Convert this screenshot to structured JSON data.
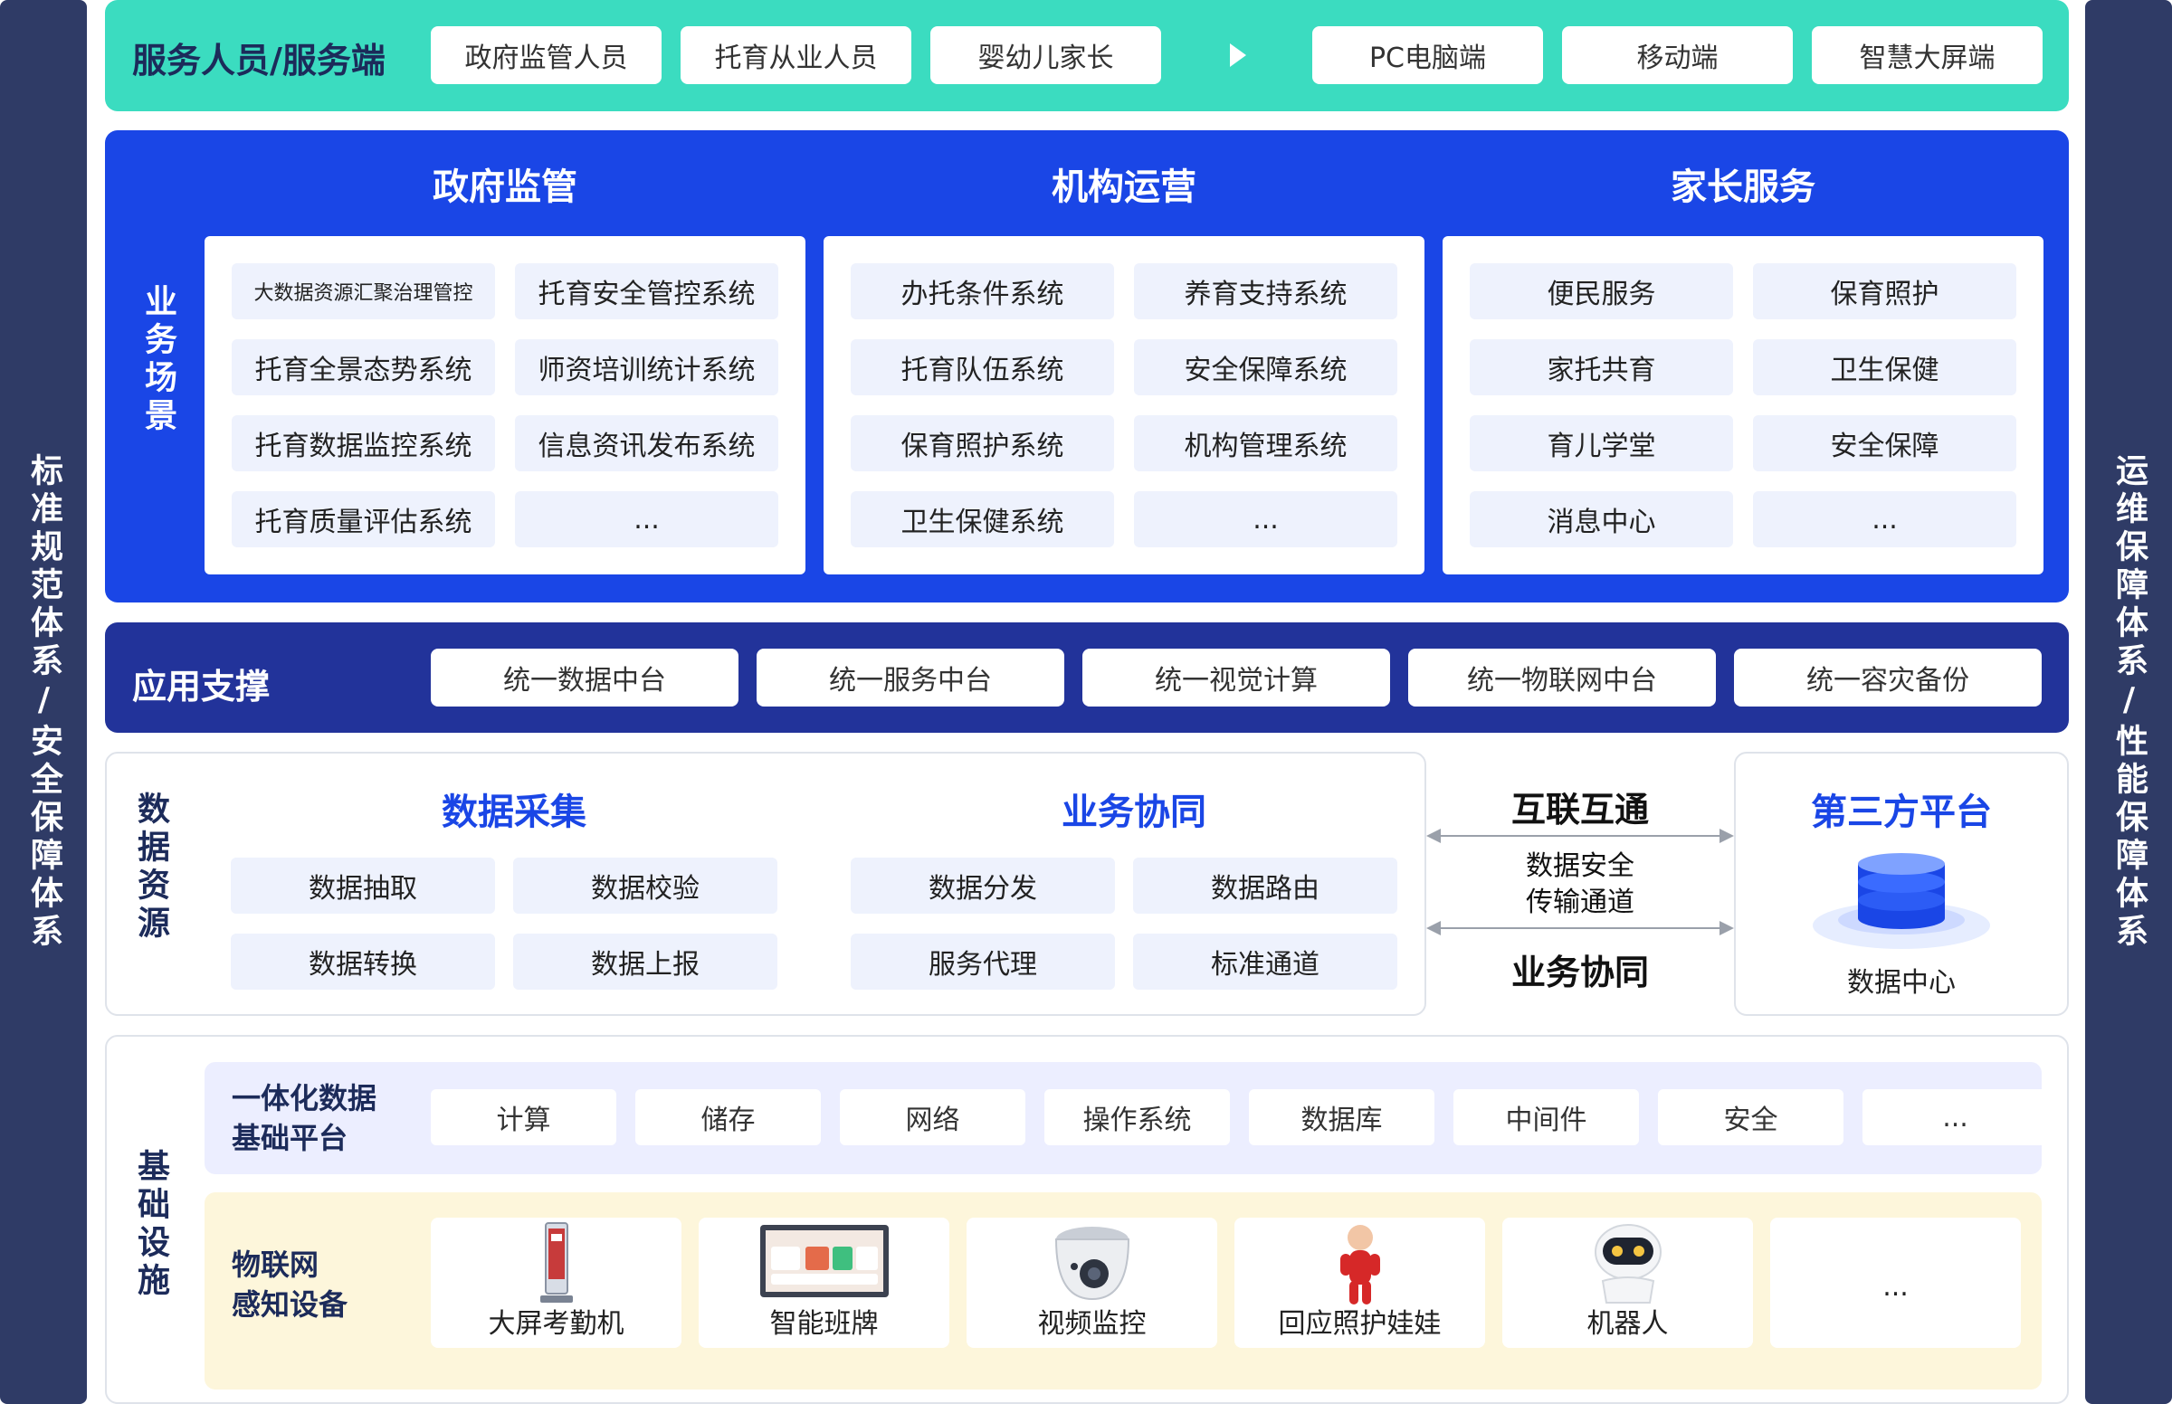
{
  "left_side": "标准规范体系/安全保障体系",
  "right_side": "运维保障体系/性能保障体系",
  "service": {
    "title": "服务人员/服务端",
    "users": [
      "政府监管人员",
      "托育从业人员",
      "婴幼儿家长"
    ],
    "terminals": [
      "PC电脑端",
      "移动端",
      "智慧大屏端"
    ]
  },
  "business": {
    "label": "业务场景",
    "columns": [
      {
        "title": "政府监管",
        "items": [
          "大数据资源汇聚治理管控",
          "托育安全管控系统",
          "托育全景态势系统",
          "师资培训统计系统",
          "托育数据监控系统",
          "信息资讯发布系统",
          "托育质量评估系统",
          "..."
        ]
      },
      {
        "title": "机构运营",
        "items": [
          "办托条件系统",
          "养育支持系统",
          "托育队伍系统",
          "安全保障系统",
          "保育照护系统",
          "机构管理系统",
          "卫生保健系统",
          "..."
        ]
      },
      {
        "title": "家长服务",
        "items": [
          "便民服务",
          "保育照护",
          "家托共育",
          "卫生保健",
          "育儿学堂",
          "安全保障",
          "消息中心",
          "..."
        ]
      }
    ]
  },
  "support": {
    "title": "应用支撑",
    "items": [
      "统一数据中台",
      "统一服务中台",
      "统一视觉计算",
      "统一物联网中台",
      "统一容灾备份"
    ]
  },
  "data": {
    "label": "数据资源",
    "groups": [
      {
        "title": "数据采集",
        "items": [
          "数据抽取",
          "数据校验",
          "数据转换",
          "数据上报"
        ]
      },
      {
        "title": "业务协同",
        "items": [
          "数据分发",
          "数据路由",
          "服务代理",
          "标准通道"
        ]
      }
    ],
    "link": {
      "top": "互联互通",
      "middle": [
        "数据安全",
        "传输通道"
      ],
      "bottom": "业务协同"
    },
    "third_party": {
      "title": "第三方平台",
      "db_label": "数据中心"
    }
  },
  "infra": {
    "label": "基础设施",
    "platform": {
      "label": [
        "一体化数据",
        "基础平台"
      ],
      "items": [
        "计算",
        "储存",
        "网络",
        "操作系统",
        "数据库",
        "中间件",
        "安全",
        "..."
      ]
    },
    "iot": {
      "label": [
        "物联网",
        "感知设备"
      ],
      "devices": [
        "大屏考勤机",
        "智能班牌",
        "视频监控",
        "回应照护娃娃",
        "机器人",
        "..."
      ]
    }
  },
  "colors": {
    "teal": "#3bdcc0",
    "blue": "#1a46e6",
    "navy": "#22339a",
    "side": "#2f3b66"
  }
}
